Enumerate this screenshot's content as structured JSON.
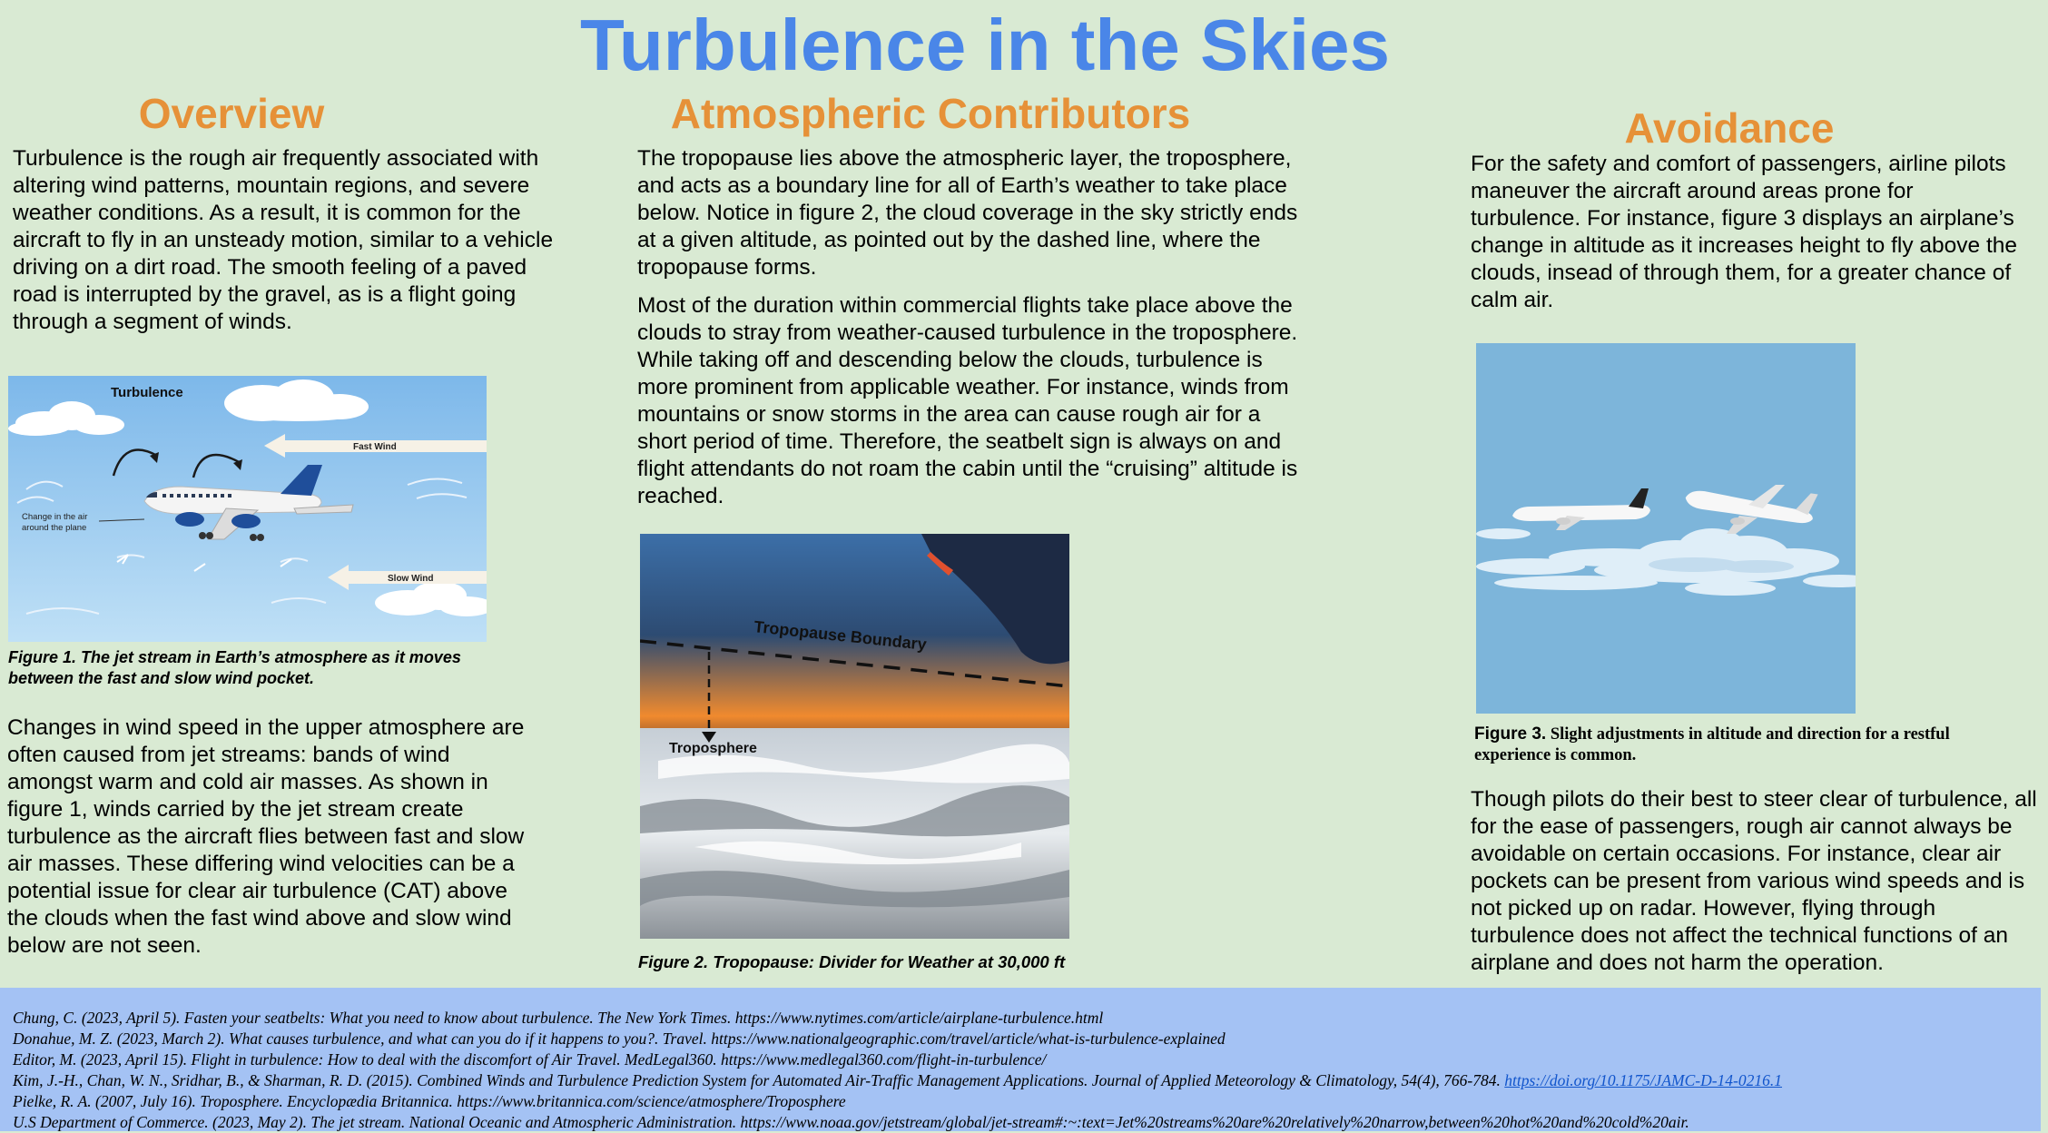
{
  "title": "Turbulence in the Skies",
  "overview": {
    "heading": "Overview",
    "para1": "Turbulence is the rough air frequently associated with altering wind patterns, mountain regions, and severe weather conditions. As a result, it is common for the aircraft to fly in an unsteady motion, similar to a vehicle driving on a dirt road. The smooth feeling of a paved road is interrupted by the gravel, as is a flight going through a segment of winds.",
    "figure1": {
      "title": "Turbulence",
      "fast_wind": "Fast Wind",
      "slow_wind": "Slow Wind",
      "change_label_1": "Change in the air",
      "change_label_2": "around the plane",
      "caption": "Figure 1. The jet stream in Earth’s atmosphere as it moves between the fast and slow wind pocket."
    },
    "para2": "Changes in wind speed in the upper atmosphere are often caused from jet streams: bands of wind amongst warm and cold air masses. As shown in figure 1, winds carried by the jet stream create turbulence as the aircraft flies between fast and slow air masses. These differing wind velocities can be a potential issue for clear air turbulence (CAT) above the clouds when the fast wind above and slow wind below are not seen."
  },
  "atmospheric": {
    "heading": "Atmospheric Contributors",
    "para1": "The tropopause lies above the atmospheric layer, the troposphere, and acts as a boundary line for all of Earth’s weather to take place below. Notice in figure 2, the cloud coverage in the sky strictly ends at a given altitude, as pointed out by the dashed line, where the tropopause forms.",
    "para2": "Most of the duration within commercial flights take place above the clouds to stray from weather-caused turbulence in the troposphere. While taking off and descending below the clouds, turbulence is more prominent from applicable weather. For instance, winds from mountains or snow storms in the area can cause rough air for a short period of time. Therefore, the seatbelt sign is always on and flight attendants do not roam the cabin until the “cruising” altitude is reached.",
    "figure2": {
      "boundary_label": "Tropopause Boundary",
      "troposphere_label": "Troposphere",
      "caption": "Figure 2. Tropopause: Divider for Weather at 30,000 ft"
    }
  },
  "avoidance": {
    "heading": "Avoidance",
    "para1": "For the safety and comfort of passengers, airline pilots maneuver the aircraft around areas prone for turbulence. For instance, figure 3 displays an airplane’s change in altitude as it increases height to fly above the clouds, insead of through them, for a greater chance of calm air.",
    "figure3": {
      "label": "Figure 3.",
      "caption": " Slight adjustments in altitude and direction for a restful experience is common."
    },
    "para2": "Though pilots do their best to steer clear of turbulence, all for the ease of passengers, rough air cannot always be avoidable on certain occasions. For instance, clear air pockets can be present from various wind speeds and is not picked up on radar. However, flying through turbulence does not affect the technical functions of an airplane and does not harm the operation."
  },
  "references": [
    "Chung, C. (2023, April 5). Fasten your seatbelts: What you need to know about turbulence. The New York Times. https://www.nytimes.com/article/airplane-turbulence.html",
    "Donahue, M. Z. (2023, March 2). What causes turbulence, and what can you do if it happens to you?. Travel. https://www.nationalgeographic.com/travel/article/what-is-turbulence-explained",
    "Editor, M. (2023, April 15). Flight in turbulence: How to deal with the discomfort of Air Travel. MedLegal360. https://www.medlegal360.com/flight-in-turbulence/",
    "Kim, J.-H., Chan, W. N., Sridhar, B., & Sharman, R. D. (2015). Combined Winds and Turbulence Prediction System for Automated Air-Traffic Management Applications. Journal of Applied Meteorology & Climatology, 54(4), 766-784. ",
    "Pielke, R. A. (2007, July 16). Troposphere. Encyclopædia Britannica. https://www.britannica.com/science/atmosphere/Troposphere",
    "U.S Department of Commerce. (2023, May 2). The jet stream. National Oceanic and Atmospheric Administration. https://www.noaa.gov/jetstream/global/jet-stream#:~:text=Jet%20streams%20are%20relatively%20narrow,between%20hot%20and%20cold%20air."
  ],
  "reference_link": "https://doi.org/10.1175/JAMC-D-14-0216.1"
}
